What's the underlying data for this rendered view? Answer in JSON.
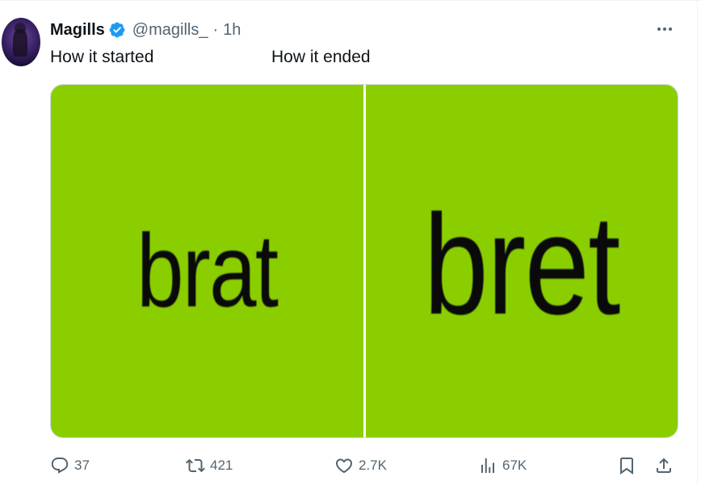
{
  "tweet": {
    "author": {
      "display_name": "Magills",
      "handle": "@magills_",
      "separator": "·",
      "time": "1h",
      "verified": true
    },
    "captions": {
      "left": "How it started",
      "right": "How it ended"
    },
    "media": {
      "background_color": "#8ace00",
      "left_text": "brat",
      "right_text": "bret"
    },
    "actions": {
      "replies": "37",
      "reposts": "421",
      "likes": "2.7K",
      "views": "67K"
    }
  },
  "icons": [
    "more-icon",
    "verified-icon",
    "reply-icon",
    "repost-icon",
    "like-icon",
    "views-icon",
    "bookmark-icon",
    "share-icon"
  ],
  "colors": {
    "text_primary": "#0f1419",
    "text_secondary": "#536471",
    "verified_blue": "#1d9bf0",
    "border": "#cfd9de"
  }
}
